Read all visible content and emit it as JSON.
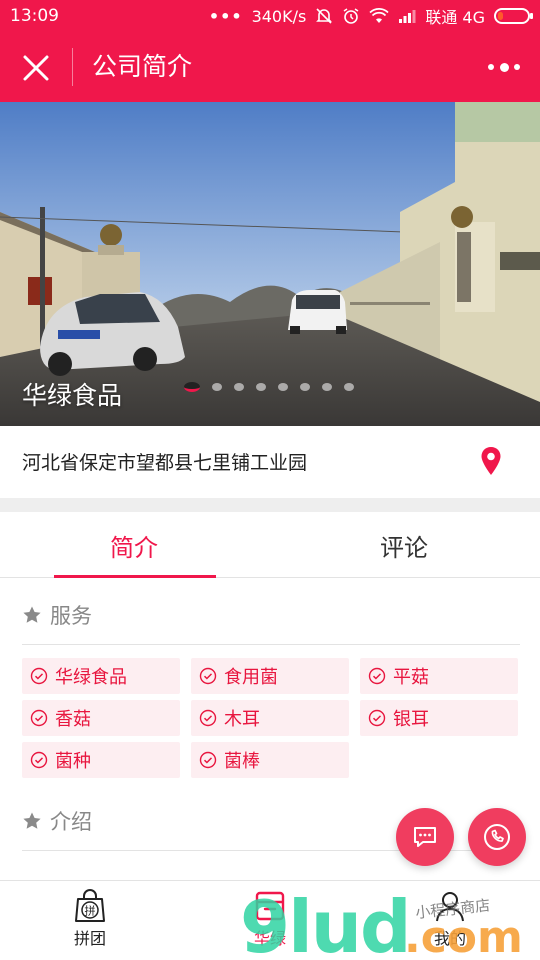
{
  "status_bar": {
    "time": "13:09",
    "speed": "340K/s",
    "carrier": "联通 4G",
    "icons": [
      "more-dots-icon",
      "mute-bell-icon",
      "alarm-icon",
      "wifi-icon",
      "signal-icon",
      "battery-icon"
    ],
    "battery_level": 0.1
  },
  "header": {
    "title": "公司简介",
    "close_icon": "close-icon",
    "more_icon": "more-dots-icon"
  },
  "hero": {
    "company_name": "华绿食品",
    "slide_count": 8,
    "active_slide": 1
  },
  "address": {
    "text": "河北省保定市望都县七里铺工业园",
    "icon": "location-pin-icon"
  },
  "tabs": [
    {
      "label": "简介",
      "active": true
    },
    {
      "label": "评论",
      "active": false
    }
  ],
  "services": {
    "title": "服务",
    "icon": "star-icon",
    "tags": [
      "华绿食品",
      "食用菌",
      "平菇",
      "香菇",
      "木耳",
      "银耳",
      "菌种",
      "菌棒"
    ]
  },
  "introduction": {
    "title": "介绍",
    "icon": "star-icon"
  },
  "fabs": {
    "chat_icon": "chat-icon",
    "phone_icon": "phone-icon"
  },
  "bottom_nav": [
    {
      "label": "拼团",
      "icon": "group-buy-bag-icon",
      "active": false
    },
    {
      "label": "华绿",
      "icon": "shop-icon",
      "active": true
    },
    {
      "label": "我的",
      "icon": "user-icon",
      "active": false
    }
  ],
  "watermark": {
    "text": "9lud.com",
    "tagline": "小程序商店"
  },
  "colors": {
    "brand": "#f0174b",
    "tag_bg": "#fdeef1",
    "fab": "#f03d5f"
  }
}
